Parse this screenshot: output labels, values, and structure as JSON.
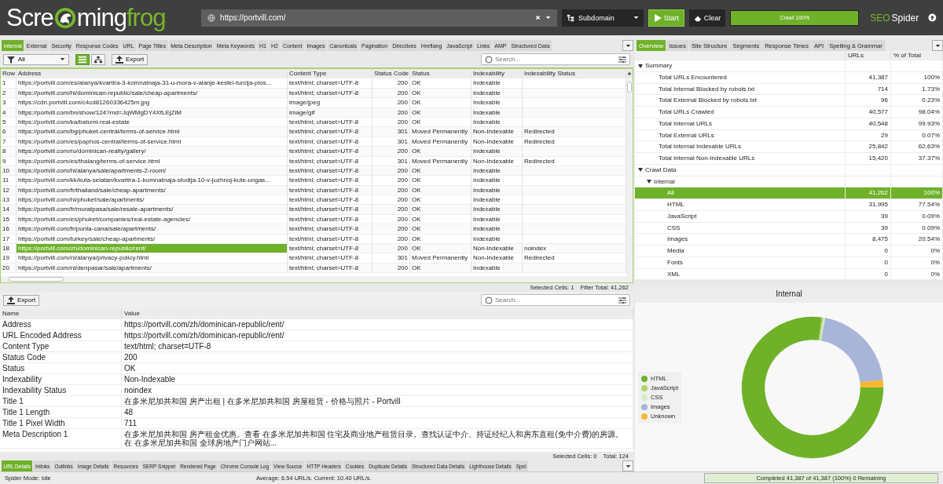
{
  "app": {
    "logo": [
      "Scre",
      "ming",
      "frog"
    ],
    "url": "https://portvill.com/",
    "mode": "Subdomain",
    "start": "Start",
    "clear": "Clear",
    "progress": {
      "label": "Crawl 100%",
      "level": 1
    },
    "brand": [
      "SEO",
      "Spider"
    ]
  },
  "tabs": [
    {
      "label": "Internal",
      "selected": true
    },
    {
      "label": "External",
      "selected": false
    },
    {
      "label": "Security",
      "selected": false
    },
    {
      "label": "Response Codes",
      "selected": false
    },
    {
      "label": "URL",
      "selected": false
    },
    {
      "label": "Page Titles",
      "selected": false
    },
    {
      "label": "Meta Description",
      "selected": false
    },
    {
      "label": "Meta Keywords",
      "selected": false
    },
    {
      "label": "H1",
      "selected": false
    },
    {
      "label": "H2",
      "selected": false
    },
    {
      "label": "Content",
      "selected": false
    },
    {
      "label": "Images",
      "selected": false
    },
    {
      "label": "Canonicals",
      "selected": false
    },
    {
      "label": "Pagination",
      "selected": false
    },
    {
      "label": "Directives",
      "selected": false
    },
    {
      "label": "Hreflang",
      "selected": false
    },
    {
      "label": "JavaScript",
      "selected": false
    },
    {
      "label": "Links",
      "selected": false
    },
    {
      "label": "AMP",
      "selected": false
    },
    {
      "label": "Structured Data",
      "selected": false
    }
  ],
  "toolbar": {
    "filter": "All",
    "views": [
      {
        "kind": "list",
        "selected": true
      },
      {
        "kind": "tree",
        "selected": false
      }
    ],
    "export": "Export",
    "search": {
      "placeholder": "Search..."
    }
  },
  "table": {
    "columns": [
      "Row",
      "Address",
      "Content Type",
      "Status Code",
      "Status",
      "Indexability",
      "Indexability Status"
    ],
    "rows": [
      {
        "row": "1",
        "address": "https://portvill.com/es/alanya/kvartira-3-komnatnaja-31-u-mora-v-alanje-kestel-turcija-plos...",
        "content_type": "text/html; charset=UTF-8",
        "status_code": "200",
        "status": "OK",
        "indexability": "Indexable",
        "indexability_status": "",
        "selected": false
      },
      {
        "row": "2",
        "address": "https://portvill.com/hi/dominican-republic/sale/cheap-apartments/",
        "content_type": "text/html; charset=UTF-8",
        "status_code": "200",
        "status": "OK",
        "indexability": "Indexable",
        "indexability_status": "",
        "selected": false
      },
      {
        "row": "3",
        "address": "https://cdn.portvill.com/c4cd81260336425m.jpg",
        "content_type": "image/jpeg",
        "status_code": "200",
        "status": "OK",
        "indexability": "Indexable",
        "indexability_status": "",
        "selected": false
      },
      {
        "row": "4",
        "address": "https://portvill.com/bn/show/124?rnd=JqWMgDY4XfLEjZiM",
        "content_type": "image/gif",
        "status_code": "200",
        "status": "OK",
        "indexability": "Indexable",
        "indexability_status": "",
        "selected": false
      },
      {
        "row": "5",
        "address": "https://portvill.com/ka/batumi-real-estate",
        "content_type": "text/html; charset=UTF-8",
        "status_code": "200",
        "status": "OK",
        "indexability": "Indexable",
        "indexability_status": "",
        "selected": false
      },
      {
        "row": "6",
        "address": "https://portvill.com/bg/phuket-central/terms-of-service.html",
        "content_type": "text/html; charset=UTF-8",
        "status_code": "301",
        "status": "Moved Permanently",
        "indexability": "Non-Indexable",
        "indexability_status": "Redirected",
        "selected": false
      },
      {
        "row": "7",
        "address": "https://portvill.com/es/paphos-central/terms-of-service.html",
        "content_type": "text/html; charset=UTF-8",
        "status_code": "301",
        "status": "Moved Permanently",
        "indexability": "Non-Indexable",
        "indexability_status": "Redirected",
        "selected": false
      },
      {
        "row": "8",
        "address": "https://portvill.com/ru/dominican-realty/gallery/",
        "content_type": "text/html; charset=UTF-8",
        "status_code": "200",
        "status": "OK",
        "indexability": "Indexable",
        "indexability_status": "",
        "selected": false
      },
      {
        "row": "9",
        "address": "https://portvill.com/es/thalang/terms-of-service.html",
        "content_type": "text/html; charset=UTF-8",
        "status_code": "301",
        "status": "Moved Permanently",
        "indexability": "Non-Indexable",
        "indexability_status": "Redirected",
        "selected": false
      },
      {
        "row": "10",
        "address": "https://portvill.com/hi/alanya/sale/apartments-2-room/",
        "content_type": "text/html; charset=UTF-8",
        "status_code": "200",
        "status": "OK",
        "indexability": "Indexable",
        "indexability_status": "",
        "selected": false
      },
      {
        "row": "11",
        "address": "https://portvill.com/kk/kuta-selatan/kvartira-1-komnatnaja-studija-10-v-juzhnoj-kute-ungas...",
        "content_type": "text/html; charset=UTF-8",
        "status_code": "200",
        "status": "OK",
        "indexability": "Indexable",
        "indexability_status": "",
        "selected": false
      },
      {
        "row": "12",
        "address": "https://portvill.com/fr/thailand/sale/cheap-apartments/",
        "content_type": "text/html; charset=UTF-8",
        "status_code": "200",
        "status": "OK",
        "indexability": "Indexable",
        "indexability_status": "",
        "selected": false
      },
      {
        "row": "13",
        "address": "https://portvill.com/hi/phuket/sale/apartments/",
        "content_type": "text/html; charset=UTF-8",
        "status_code": "200",
        "status": "OK",
        "indexability": "Indexable",
        "indexability_status": "",
        "selected": false
      },
      {
        "row": "14",
        "address": "https://portvill.com/fr/muratpasa/sale/resale-apartments/",
        "content_type": "text/html; charset=UTF-8",
        "status_code": "200",
        "status": "OK",
        "indexability": "Indexable",
        "indexability_status": "",
        "selected": false
      },
      {
        "row": "15",
        "address": "https://portvill.com/es/phuket/companies/real-estate-agencies/",
        "content_type": "text/html; charset=UTF-8",
        "status_code": "200",
        "status": "OK",
        "indexability": "Indexable",
        "indexability_status": "",
        "selected": false
      },
      {
        "row": "16",
        "address": "https://portvill.com/fr/punta-cana/sale/apartments/",
        "content_type": "text/html; charset=UTF-8",
        "status_code": "200",
        "status": "OK",
        "indexability": "Indexable",
        "indexability_status": "",
        "selected": false
      },
      {
        "row": "17",
        "address": "https://portvill.com/turkey/sale/cheap-apartments/",
        "content_type": "text/html; charset=UTF-8",
        "status_code": "200",
        "status": "OK",
        "indexability": "Indexable",
        "indexability_status": "",
        "selected": false
      },
      {
        "row": "18",
        "address": "https://portvill.com/zh/dominican-republic/rent/",
        "content_type": "text/html; charset=UTF-8",
        "status_code": "200",
        "status": "OK",
        "indexability": "Non-Indexable",
        "indexability_status": "noindex",
        "selected": true
      },
      {
        "row": "19",
        "address": "https://portvill.com/nl/alanya/privacy-policy.html",
        "content_type": "text/html; charset=UTF-8",
        "status_code": "301",
        "status": "Moved Permanently",
        "indexability": "Non-Indexable",
        "indexability_status": "Redirected",
        "selected": false
      },
      {
        "row": "20",
        "address": "https://portvill.com/nl/denpasar/sale/apartments/",
        "content_type": "text/html; charset=UTF-8",
        "status_code": "200",
        "status": "OK",
        "indexability": "Indexable",
        "indexability_status": "",
        "selected": false
      }
    ],
    "status": [
      "Selected Cells: 1",
      "Filter Total: 41,262"
    ]
  },
  "details": {
    "export": "Export",
    "search": {
      "placeholder": "Search..."
    },
    "columns": [
      "Name",
      "Value"
    ],
    "rows": [
      {
        "name": "Address",
        "value": "https://portvill.com/zh/dominican-republic/rent/"
      },
      {
        "name": "URL Encoded Address",
        "value": "https://portvill.com/zh/dominican-republic/rent/"
      },
      {
        "name": "Content Type",
        "value": "text/html; charset=UTF-8"
      },
      {
        "name": "Status Code",
        "value": "200"
      },
      {
        "name": "Status",
        "value": "OK"
      },
      {
        "name": "Indexability",
        "value": "Non-Indexable"
      },
      {
        "name": "Indexability Status",
        "value": "noindex"
      },
      {
        "name": "Title 1",
        "value": "在多米尼加共和国 房产出租 | 在多米尼加共和国 房屋租赁 - 价格与照片 - Portvill"
      },
      {
        "name": "Title 1 Length",
        "value": "48"
      },
      {
        "name": "Title 1 Pixel Width",
        "value": "711"
      },
      {
        "name": "Meta Description 1",
        "value": "在多米尼加共和国 房产租金优惠。查看 在多米尼加共和国 住宅及商业地产租赁目录。查找认证中介、持证经纪人和房东直租(免中介费)的房源。在 在多米尼加共和国 全球房地产门户网站..."
      }
    ],
    "status": [
      "Selected Cells: 0",
      "Total: 124"
    ]
  },
  "overview": {
    "tabs": [
      {
        "label": "Overview",
        "selected": true
      },
      {
        "label": "Issues",
        "selected": false
      },
      {
        "label": "Site Structure",
        "selected": false
      },
      {
        "label": "Segments",
        "selected": false
      },
      {
        "label": "Response Times",
        "selected": false
      },
      {
        "label": "API",
        "selected": false
      },
      {
        "label": "Spelling & Grammar",
        "selected": false
      }
    ],
    "columns": [
      "URLs",
      "% of Total"
    ],
    "rows": [
      {
        "label": "Summary",
        "expanded": true,
        "selected": false,
        "children": [
          {
            "label": "Total URLs Encountered",
            "urls": "41,387",
            "pct": "100%",
            "selected": false
          },
          {
            "label": "Total Internal Blocked by robots.txt",
            "urls": "714",
            "pct": "1.73%",
            "selected": false
          },
          {
            "label": "Total External Blocked by robots.txt",
            "urls": "96",
            "pct": "0.23%",
            "selected": false
          },
          {
            "label": "Total URLs Crawled",
            "urls": "40,577",
            "pct": "98.04%",
            "selected": false
          },
          {
            "label": "Total Internal URLs",
            "urls": "40,548",
            "pct": "99.93%",
            "selected": false
          },
          {
            "label": "Total External URLs",
            "urls": "29",
            "pct": "0.07%",
            "selected": false
          },
          {
            "label": "Total Internal Indexable URLs",
            "urls": "25,842",
            "pct": "62.63%",
            "selected": false
          },
          {
            "label": "Total Internal Non-Indexable URLs",
            "urls": "15,420",
            "pct": "37.37%",
            "selected": false
          }
        ]
      },
      {
        "label": "Crawl Data",
        "expanded": true,
        "selected": false,
        "children": [
          {
            "label": "Internal",
            "expanded": true,
            "selected": false,
            "children": [
              {
                "label": "All",
                "urls": "41,262",
                "pct": "100%",
                "selected": true
              },
              {
                "label": "HTML",
                "urls": "31,995",
                "pct": "77.54%",
                "selected": false
              },
              {
                "label": "JavaScript",
                "urls": "39",
                "pct": "0.09%",
                "selected": false
              },
              {
                "label": "CSS",
                "urls": "39",
                "pct": "0.09%",
                "selected": false
              },
              {
                "label": "Images",
                "urls": "8,475",
                "pct": "20.54%",
                "selected": false
              },
              {
                "label": "Media",
                "urls": "0",
                "pct": "0%",
                "selected": false
              },
              {
                "label": "Fonts",
                "urls": "0",
                "pct": "0%",
                "selected": false
              },
              {
                "label": "XML",
                "urls": "0",
                "pct": "0%",
                "selected": false
              }
            ]
          }
        ]
      }
    ]
  },
  "chart": {
    "chart_data": {
      "type": "donut",
      "title": "Internal",
      "legend": "left",
      "categories": [
        "HTML",
        "JavaScript",
        "CSS",
        "Images",
        "Unknown"
      ],
      "colors": [
        "#6fb22a",
        "#b5d36a",
        "#d6ebc7",
        "#a8b5d8",
        "#f7b733"
      ],
      "values": [
        77.54,
        0.09,
        0.09,
        20.54,
        1.74
      ]
    }
  },
  "bottom_tabs": [
    {
      "label": "URL Details",
      "selected": true
    },
    {
      "label": "Inlinks",
      "selected": false
    },
    {
      "label": "Outlinks",
      "selected": false
    },
    {
      "label": "Image Details",
      "selected": false
    },
    {
      "label": "Resources",
      "selected": false
    },
    {
      "label": "SERP Snippet",
      "selected": false
    },
    {
      "label": "Rendered Page",
      "selected": false
    },
    {
      "label": "Chrome Console Log",
      "selected": false
    },
    {
      "label": "View Source",
      "selected": false
    },
    {
      "label": "HTTP Headers",
      "selected": false
    },
    {
      "label": "Cookies",
      "selected": false
    },
    {
      "label": "Duplicate Details",
      "selected": false
    },
    {
      "label": "Structured Data Details",
      "selected": false
    },
    {
      "label": "Lighthouse Details",
      "selected": false
    },
    {
      "label": "Spel",
      "selected": false
    }
  ],
  "status_bar": {
    "mode": "Spider Mode: Idle",
    "speed": "Average: 6.54 URL/s. Current: 10.40 URL/s.",
    "progress": {
      "label": "Completed 41,387 of 41,387 (100%) 0 Remaining",
      "level": 1
    }
  }
}
